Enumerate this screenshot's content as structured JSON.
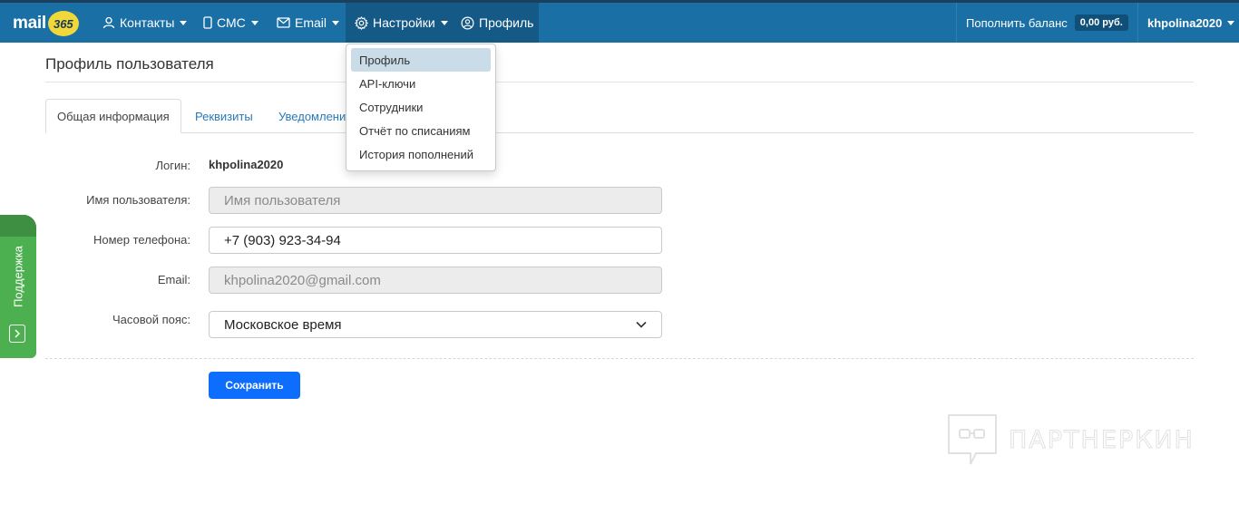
{
  "navbar": {
    "logo_text": "mail",
    "logo_number": "365",
    "items": [
      {
        "label": "Контакты",
        "icon": "user-icon"
      },
      {
        "label": "СМС",
        "icon": "phone-icon"
      },
      {
        "label": "Email",
        "icon": "envelope-icon"
      },
      {
        "label": "Настройки",
        "icon": "gear-icon"
      },
      {
        "label": "Профиль",
        "icon": "user-circle-icon"
      }
    ],
    "balance_label": "Пополнить баланс",
    "balance_value": "0,00 руб.",
    "username": "khpolina2020"
  },
  "settings_menu": {
    "items": [
      "Профиль",
      "API-ключи",
      "Сотрудники",
      "Отчёт по списаниям",
      "История пополнений"
    ],
    "active_index": 0
  },
  "page": {
    "title": "Профиль пользователя",
    "tabs": [
      "Общая информация",
      "Реквизиты",
      "Уведомления"
    ]
  },
  "form": {
    "login_label": "Логин:",
    "login_value": "khpolina2020",
    "username_label": "Имя пользователя:",
    "username_placeholder": "Имя пользователя",
    "phone_label": "Номер телефона:",
    "phone_value": "+7 (903) 923-34-94",
    "email_label": "Email:",
    "email_value": "khpolina2020@gmail.com",
    "timezone_label": "Часовой пояс:",
    "timezone_value": "Московское время",
    "save_label": "Сохранить"
  },
  "support": {
    "label": "Поддержка"
  },
  "watermark": {
    "text": "ПАРТНЕРКИН"
  },
  "colors": {
    "navbar": "#1a6fa5",
    "primary_button": "#0d6efd",
    "support_tab": "#4caf50",
    "logo_badge": "#f1d83a"
  }
}
